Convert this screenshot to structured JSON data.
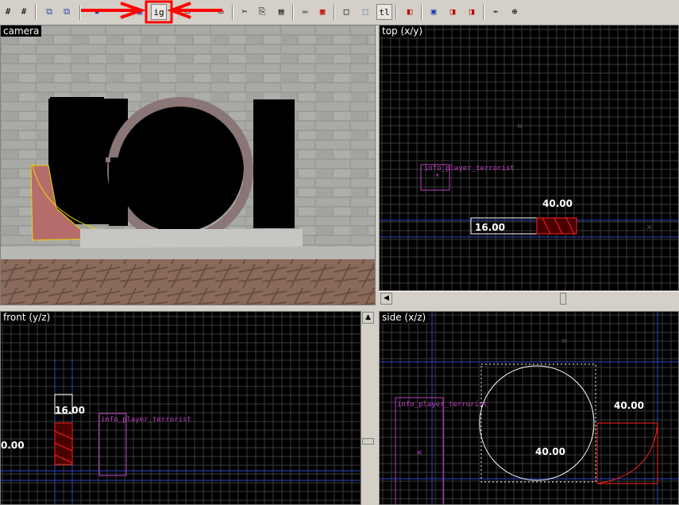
{
  "toolbar": {
    "icons": [
      "grid-toggle-icon",
      "grid-snap-icon",
      "group-select-icon",
      "group-ignore-icon",
      "carve-icon",
      "hollow-icon",
      "ignore-grouping-icon",
      "toggle-cordon-icon",
      "texture-lock-icon",
      "cut-icon",
      "copy-icon",
      "paste-icon",
      "show-textures-icon",
      "texture-browser-icon",
      "select-brush-icon",
      "select-face-icon",
      "texture-application-icon",
      "flip-icon",
      "open-icon",
      "vmf-save-icon",
      "run-map-icon",
      "entity-report-icon",
      "center-view-icon"
    ],
    "ignore_grouping_label": "ig",
    "texture_app_label": "tl"
  },
  "viewports": {
    "camera": {
      "label": "camera"
    },
    "top": {
      "label": "top (x/y)",
      "entity_label": "info_player_terrorist",
      "dim_width": "40.00",
      "dim_height": "16.00"
    },
    "front": {
      "label": "front (y/z)",
      "entity_label": "info_player_terrorist",
      "dim_left": "0.00",
      "dim_top": "16.00"
    },
    "side": {
      "label": "side (x/z)",
      "entity_label": "info_player_terrorist",
      "dim_top": "40.00",
      "dim_left": "40.00"
    }
  },
  "colors": {
    "grid": "#3c3c3c",
    "grid_major": "#2d47c8",
    "selection": "#ff2020",
    "entity": "#c040c0",
    "annotation_arrow": "#ff0000"
  }
}
